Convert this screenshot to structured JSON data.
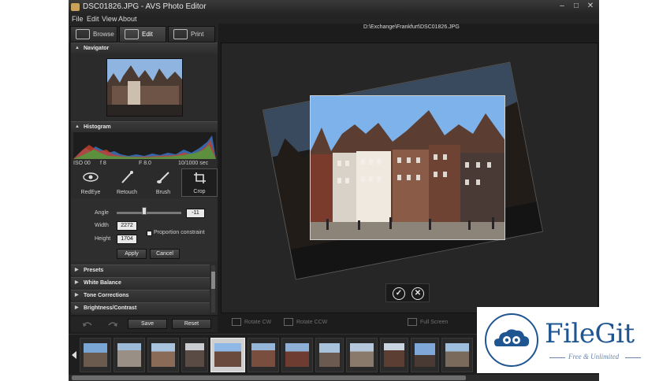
{
  "window": {
    "title": "DSC01826.JPG - AVS Photo Editor",
    "controls": [
      "–",
      "□",
      "✕"
    ]
  },
  "menu": [
    "File",
    "Edit",
    "View",
    "About"
  ],
  "tabs": [
    {
      "label": "Browse",
      "icon": "browse-icon"
    },
    {
      "label": "Edit",
      "icon": "edit-icon",
      "active": true
    },
    {
      "label": "Print",
      "icon": "print-icon"
    }
  ],
  "filepath": "D:\\Exchange\\Frankfurt\\DSC01826.JPG",
  "navigator": {
    "title": "Navigator"
  },
  "histogram": {
    "title": "Histogram",
    "iso": "ISO 00",
    "f1": "f 8",
    "f2": "F 8.0",
    "shutter": "10/1000 sec"
  },
  "tools": [
    {
      "label": "RedEye",
      "icon": "redeye-icon"
    },
    {
      "label": "Retouch",
      "icon": "retouch-icon"
    },
    {
      "label": "Brush",
      "icon": "brush-icon"
    },
    {
      "label": "Crop",
      "icon": "crop-icon",
      "active": true
    }
  ],
  "crop": {
    "angle_label": "Angle",
    "angle_value": "-11",
    "width_label": "Width",
    "width_value": "2272",
    "height_label": "Height",
    "height_value": "1704",
    "proportion_label": "Proportion constraint",
    "apply": "Apply",
    "cancel": "Cancel"
  },
  "sections": [
    "Presets",
    "White Balance",
    "Tone Corrections",
    "Brightness/Contrast"
  ],
  "bottom": {
    "save": "Save",
    "reset": "Reset"
  },
  "viewtools": {
    "rotate_cw": "Rotate CW",
    "rotate_ccw": "Rotate CCW",
    "fullscreen": "Full Screen"
  },
  "watermark": {
    "brand": "FileGit",
    "tagline": "Free & Unlimited"
  },
  "colors": {
    "accent": "#1f5591",
    "panel": "#2b2b2b",
    "background": "#1c1c1c"
  }
}
